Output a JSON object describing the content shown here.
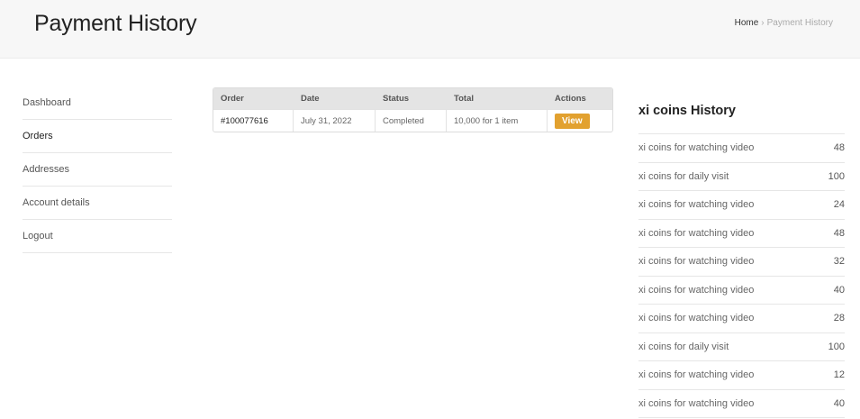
{
  "header": {
    "title": "Payment History",
    "breadcrumb": {
      "home": "Home",
      "separator": "›",
      "current": "Payment History"
    }
  },
  "sidebar": {
    "items": [
      {
        "label": "Dashboard"
      },
      {
        "label": "Orders"
      },
      {
        "label": "Addresses"
      },
      {
        "label": "Account details"
      },
      {
        "label": "Logout"
      }
    ]
  },
  "orders": {
    "columns": [
      "Order",
      "Date",
      "Status",
      "Total",
      "Actions"
    ],
    "rows": [
      {
        "order": "#100077616",
        "date": "July 31, 2022",
        "status": "Completed",
        "total": "10,000 for 1 item",
        "action": "View"
      }
    ]
  },
  "coins": {
    "title": "xi coins History",
    "rows": [
      {
        "label": "xi coins for watching video",
        "amount": "48"
      },
      {
        "label": "xi coins for daily visit",
        "amount": "100"
      },
      {
        "label": "xi coins for watching video",
        "amount": "24"
      },
      {
        "label": "xi coins for watching video",
        "amount": "48"
      },
      {
        "label": "xi coins for watching video",
        "amount": "32"
      },
      {
        "label": "xi coins for watching video",
        "amount": "40"
      },
      {
        "label": "xi coins for watching video",
        "amount": "28"
      },
      {
        "label": "xi coins for daily visit",
        "amount": "100"
      },
      {
        "label": "xi coins for watching video",
        "amount": "12"
      },
      {
        "label": "xi coins for watching video",
        "amount": "40"
      }
    ]
  },
  "colors": {
    "accent": "#e2a12f",
    "header_bg": "#f7f7f7"
  }
}
